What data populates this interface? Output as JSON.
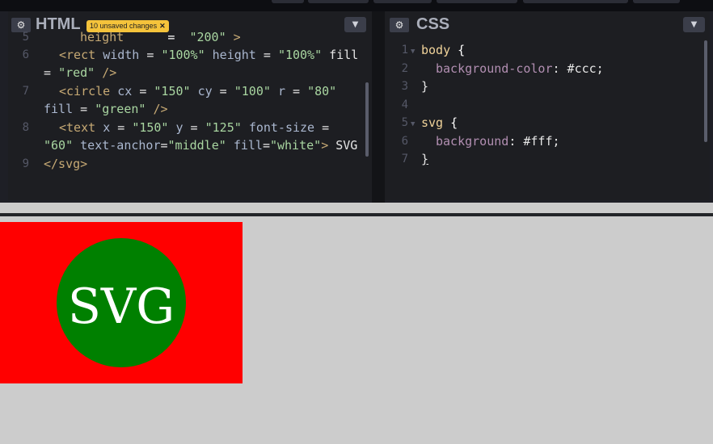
{
  "html_panel": {
    "title": "HTML",
    "badge": "10 unsaved changes",
    "badge_close": "✕",
    "settings_icon": "gear-icon",
    "dropdown_icon": "chevron-down-icon",
    "lines": [
      {
        "n": "5",
        "text": "height = \"200\" >"
      },
      {
        "n": "6",
        "text": "<rect width = \"100%\" height = \"100%\" fill = \"red\" />"
      },
      {
        "n": "7",
        "text": "<circle cx = \"150\" cy = \"100\" r = \"80\" fill = \"green\" />"
      },
      {
        "n": "8",
        "text": "<text x = \"150\" y = \"125\" font-size = \"60\" text-anchor=\"middle\" fill=\"white\"> SVG"
      },
      {
        "n": "9",
        "text": "</svg>"
      }
    ],
    "line6_part1": "<rect width = \"100%\" height = \"100%\" fill",
    "line6_part2": "= \"red\" />",
    "line7_part1": "<circle cx = \"150\" cy = \"100\" r = \"80\"",
    "line7_part2": "fill = \"green\" />",
    "line8_part1": "<text x = \"150\" y = \"125\" font-size =",
    "line8_part2": "\"60\" text-anchor=\"middle\" fill=\"white\"> SVG",
    "line9": "</svg>",
    "line5_partial": "height = \"200\" >"
  },
  "css_panel": {
    "title": "CSS",
    "settings_icon": "gear-icon",
    "dropdown_icon": "chevron-down-icon",
    "lines": [
      {
        "n": "1",
        "text": "body {"
      },
      {
        "n": "2",
        "text": "background-color: #ccc;"
      },
      {
        "n": "3",
        "text": "}"
      },
      {
        "n": "4",
        "text": ""
      },
      {
        "n": "5",
        "text": "svg {"
      },
      {
        "n": "6",
        "text": "background: #fff;"
      },
      {
        "n": "7",
        "text": "}"
      }
    ]
  },
  "preview": {
    "svg_text": "SVG",
    "rect_fill": "#ff0000",
    "circle_fill": "#008000",
    "text_fill": "#ffffff",
    "page_bg": "#cccccc"
  },
  "colors": {
    "editor_bg": "#1d1e22",
    "badge_bg": "#f5c33b"
  }
}
